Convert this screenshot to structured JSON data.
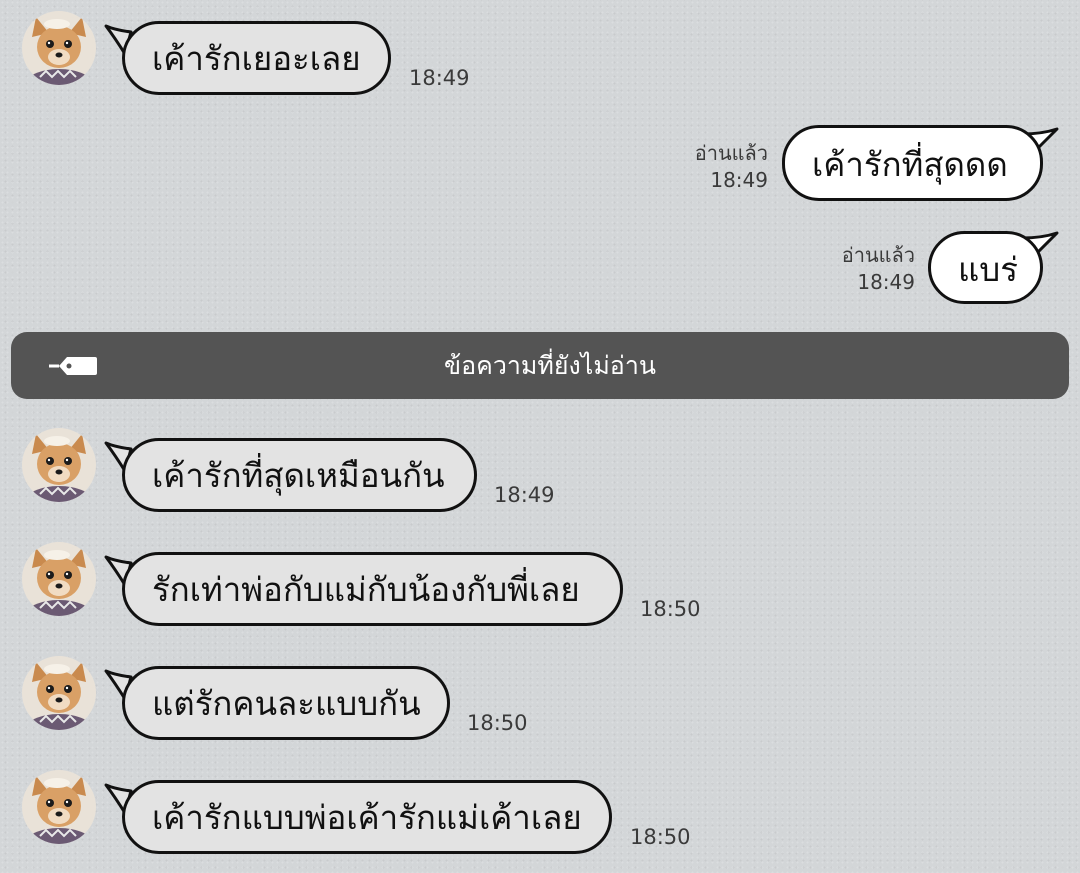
{
  "messages_before": [
    {
      "text": "เค้ารักเยอะเลย",
      "time": "18:49"
    }
  ],
  "sent_messages": [
    {
      "text": "เค้ารักที่สุดดด",
      "read_label": "อ่านแล้ว",
      "time": "18:49"
    },
    {
      "text": "แบร่",
      "read_label": "อ่านแล้ว",
      "time": "18:49"
    }
  ],
  "unread_divider": {
    "label": "ข้อความที่ยังไม่อ่าน",
    "icon": "tag-icon"
  },
  "messages_after": [
    {
      "text": "เค้ารักที่สุดเหมือนกัน",
      "time": "18:49"
    },
    {
      "text": "รักเท่าพ่อกับแม่กับน้องกับพี่เลย",
      "time": "18:50"
    },
    {
      "text": "แต่รักคนละแบบกัน",
      "time": "18:50"
    },
    {
      "text": "เค้ารักแบบพ่อเค้ารักแม่เค้าเลย",
      "time": "18:50"
    }
  ],
  "colors": {
    "background": "#d3d6d8",
    "incoming_bubble": "#e3e3e3",
    "outgoing_bubble": "#ffffff",
    "divider": "#545454"
  }
}
